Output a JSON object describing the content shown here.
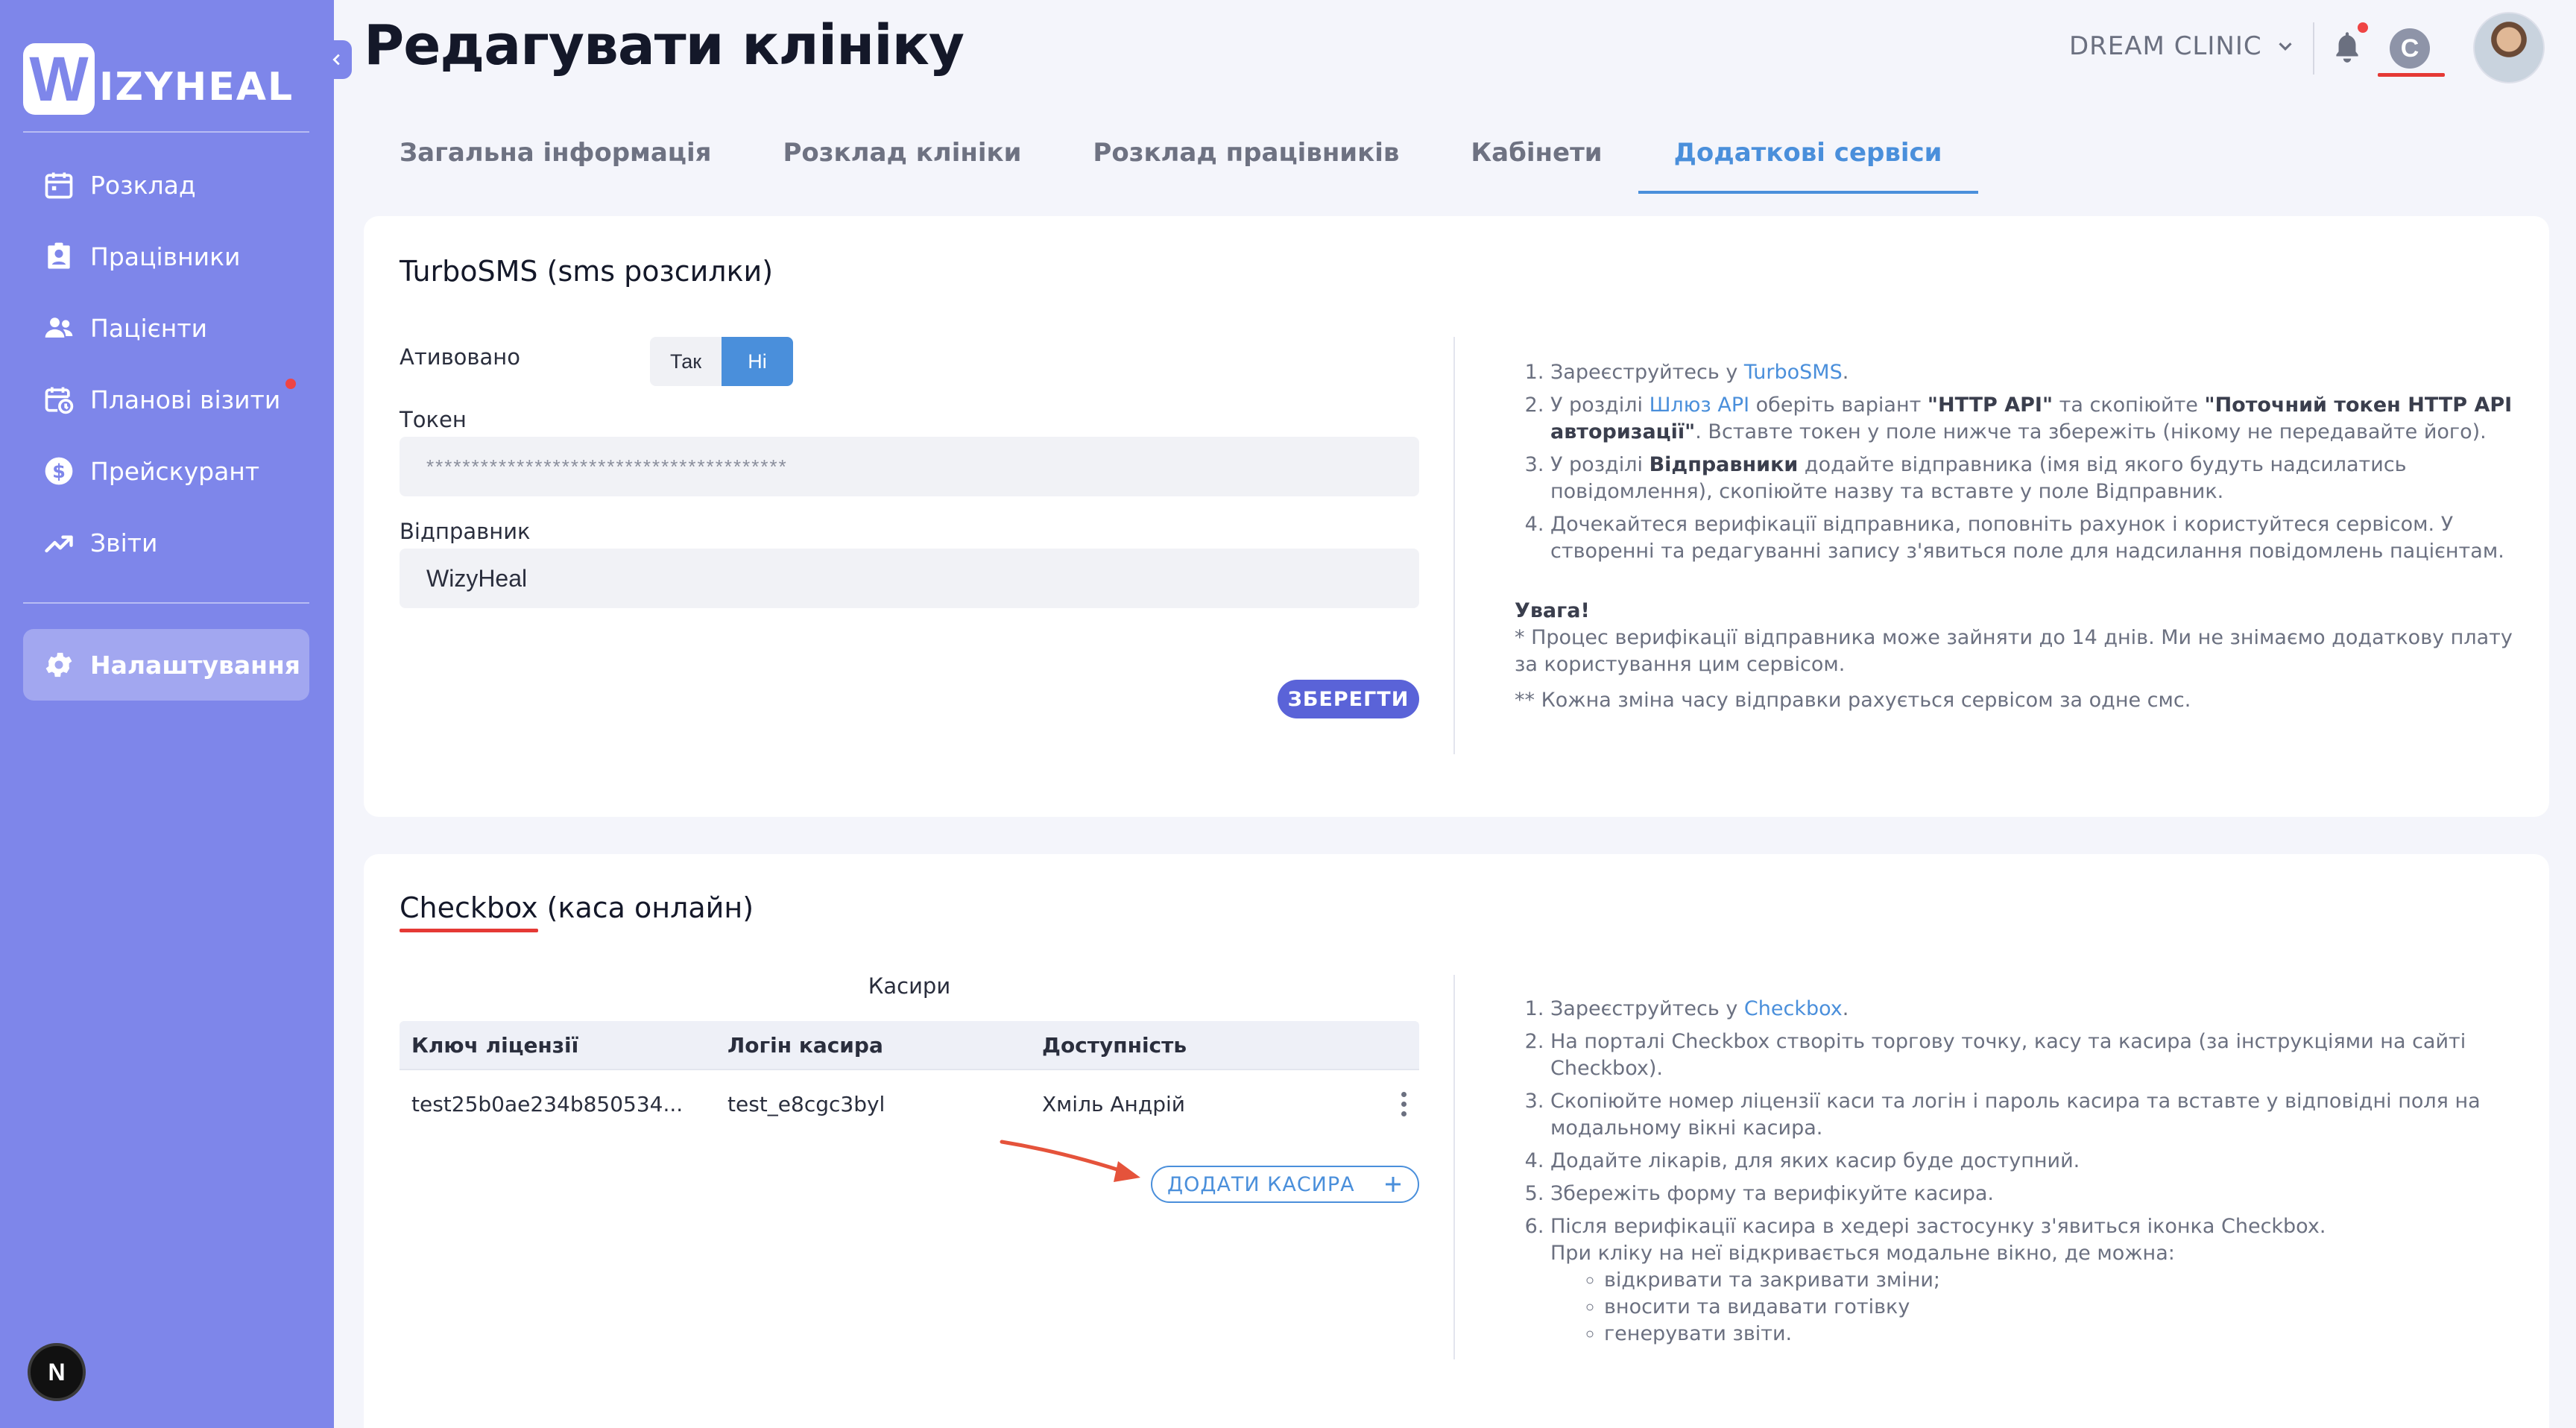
{
  "app": {
    "logo_letter": "W",
    "logo_text": "IZYHEAL",
    "user_initial": "N"
  },
  "sidebar": {
    "items": [
      {
        "label": "Розклад",
        "icon": "calendar-icon"
      },
      {
        "label": "Працівники",
        "icon": "badge-icon"
      },
      {
        "label": "Пацієнти",
        "icon": "people-icon"
      },
      {
        "label": "Планові візити",
        "icon": "calendar-clock-icon"
      },
      {
        "label": "Прейскурант",
        "icon": "dollar-icon"
      },
      {
        "label": "Звіти",
        "icon": "trend-icon"
      }
    ],
    "settings_label": "Налаштування"
  },
  "header": {
    "title": "Редагувати клініку",
    "clinic": "DREAM CLINIC",
    "checkbox_initial": "C"
  },
  "tabs": [
    {
      "label": "Загальна інформація",
      "active": false
    },
    {
      "label": "Розклад клініки",
      "active": false
    },
    {
      "label": "Розклад працівників",
      "active": false
    },
    {
      "label": "Кабінети",
      "active": false
    },
    {
      "label": "Додаткові сервіси",
      "active": true
    }
  ],
  "turbosms": {
    "title": "TurboSMS (sms розсилки)",
    "activated_label": "Ативовано",
    "yes": "Так",
    "no": "Ні",
    "token_label": "Токен",
    "token_value": "****************************************",
    "sender_label": "Відправник",
    "sender_value": "WizyHeal",
    "save": "ЗБЕРЕГТИ",
    "steps": [
      {
        "pre": "Зареєструйтесь у ",
        "link": "TurboSMS",
        "post": "."
      },
      {
        "html": "У розділі <a>Шлюз API</a> оберіть варіант <b>\"HTTP API\"</b> та скопіюйте <b>\"Поточний токен HTTP API авторизації\"</b>. Вставте токен у поле нижче та збережіть (нікому не передавайте його)."
      },
      {
        "html": "У розділі <b>Відправники</b> додайте відправника (імя від якого будуть надсилатись повідомлення), скопіюйте назву та вставте у поле Відправник."
      },
      {
        "html": "Дочекайтеся верифікації відправника, поповніть рахунок і користуйтеся сервісом. У створенні та редагуванні запису з'явиться поле для надсилання повідомлень пацієнтам."
      }
    ],
    "note_title": "Увага!",
    "note_1": "* Процес верифікації відправника може зайняти до 14 днів. Ми не знімаємо додаткову плату за користування цим сервісом.",
    "note_2": "** Кожна зміна часу відправки рахується сервісом за одне смс."
  },
  "checkbox": {
    "title_main": "Checkbox",
    "title_rest": " (каса онлайн)",
    "table_caption": "Касири",
    "columns": [
      "Ключ ліцензії",
      "Логін касира",
      "Доступність"
    ],
    "rows": [
      {
        "license": "test25b0ae234b850534...",
        "login": "test_e8cgc3byl",
        "available": "Хміль Андрій"
      }
    ],
    "add_label": "ДОДАТИ КАСИРА",
    "steps": [
      {
        "pre": "Зареєструйтесь у ",
        "link": "Checkbox",
        "post": "."
      },
      {
        "text": "На порталі Checkbox створіть торгову точку, касу та касира (за інструкціями на сайті Checkbox)."
      },
      {
        "text": "Скопіюйте номер ліцензії каси та логін і пароль касира та вставте у відповідні поля на модальному вікні касира."
      },
      {
        "text": "Додайте лікарів, для яких касир буде доступний."
      },
      {
        "text": "Збережіть форму та верифікуйте касира."
      },
      {
        "text": "Після верифікації касира в хедері застосунку з'явиться іконка Checkbox."
      }
    ],
    "modal_intro": "При кліку на неї відкривається модальне вікно, де можна:",
    "modal_items": [
      "відкривати та закривати зміни;",
      "вносити та видавати готівку",
      "генерувати звіти."
    ]
  },
  "colors": {
    "sidebar": "#7e86ea",
    "accent": "#4a8fdb",
    "primary_button": "#5a63d8",
    "highlight": "#e53935"
  }
}
